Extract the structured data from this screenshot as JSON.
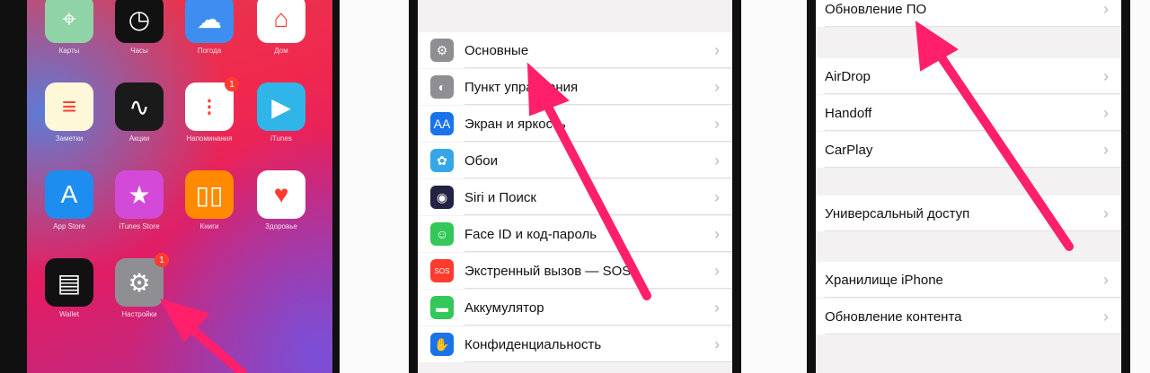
{
  "home": {
    "apps": [
      {
        "label": "Карты",
        "icon": "maps-icon",
        "color": "#8fd3a6",
        "glyph": "⌖"
      },
      {
        "label": "Часы",
        "icon": "clock-icon",
        "color": "#111111",
        "glyph": "◷"
      },
      {
        "label": "Погода",
        "icon": "weather-icon",
        "color": "#3d8ef0",
        "glyph": "☁"
      },
      {
        "label": "Дом",
        "icon": "home-icon",
        "color": "#ffffff",
        "glyph": "⌂"
      },
      {
        "label": "Заметки",
        "icon": "notes-icon",
        "color": "#fff8d8",
        "glyph": "≡"
      },
      {
        "label": "Акции",
        "icon": "stocks-icon",
        "color": "#1a1a1a",
        "glyph": "∿"
      },
      {
        "label": "Напоминания",
        "icon": "reminders-icon",
        "color": "#ffffff",
        "glyph": "⁝",
        "badge": "1"
      },
      {
        "label": "iTunes",
        "icon": "itunes-icon",
        "color": "#2fb5e8",
        "glyph": "▶"
      },
      {
        "label": "App Store",
        "icon": "app-store-icon",
        "color": "#1d8df0",
        "glyph": "A"
      },
      {
        "label": "iTunes Store",
        "icon": "itunes-store-icon",
        "color": "#d34ad8",
        "glyph": "★"
      },
      {
        "label": "Книги",
        "icon": "books-icon",
        "color": "#ff8a00",
        "glyph": "▯▯"
      },
      {
        "label": "Здоровье",
        "icon": "health-icon",
        "color": "#ffffff",
        "glyph": "♥"
      },
      {
        "label": "Wallet",
        "icon": "wallet-icon",
        "color": "#111111",
        "glyph": "▤"
      },
      {
        "label": "Настройки",
        "icon": "settings-gear-icon",
        "color": "#8e8e93",
        "glyph": "⚙",
        "badge": "1"
      }
    ]
  },
  "settings1": {
    "rows": [
      {
        "label": "Основные",
        "icon": "gear-icon",
        "color": "#8e8e93",
        "glyph": "⚙"
      },
      {
        "label": "Пункт управления",
        "icon": "control-center-icon",
        "color": "#8e8e93",
        "glyph": "◐"
      },
      {
        "label": "Экран и яркость",
        "icon": "display-icon",
        "color": "#1a73e8",
        "glyph": "AA"
      },
      {
        "label": "Обои",
        "icon": "wallpaper-icon",
        "color": "#35a6e8",
        "glyph": "✿"
      },
      {
        "label": "Siri и Поиск",
        "icon": "siri-icon",
        "color": "#222244",
        "glyph": "◉"
      },
      {
        "label": "Face ID и код-пароль",
        "icon": "face-id-icon",
        "color": "#34c759",
        "glyph": "☺"
      },
      {
        "label": "Экстренный вызов — SOS",
        "icon": "sos-icon",
        "color": "#ff3b30",
        "glyph": "SOS"
      },
      {
        "label": "Аккумулятор",
        "icon": "battery-icon",
        "color": "#34c759",
        "glyph": "▬"
      },
      {
        "label": "Конфиденциальность",
        "icon": "privacy-hand-icon",
        "color": "#1a73e8",
        "glyph": "✋"
      }
    ]
  },
  "settings2": {
    "rows": [
      {
        "label": "Обновление ПО",
        "group": 0
      },
      {
        "label": "AirDrop",
        "group": 1
      },
      {
        "label": "Handoff",
        "group": 1
      },
      {
        "label": "CarPlay",
        "group": 1
      },
      {
        "label": "Универсальный доступ",
        "group": 2
      },
      {
        "label": "Хранилище iPhone",
        "group": 3
      },
      {
        "label": "Обновление контента",
        "group": 3
      }
    ]
  },
  "colors": {
    "arrow": "#ff1f6b",
    "chevron": "#bbbbbb"
  }
}
